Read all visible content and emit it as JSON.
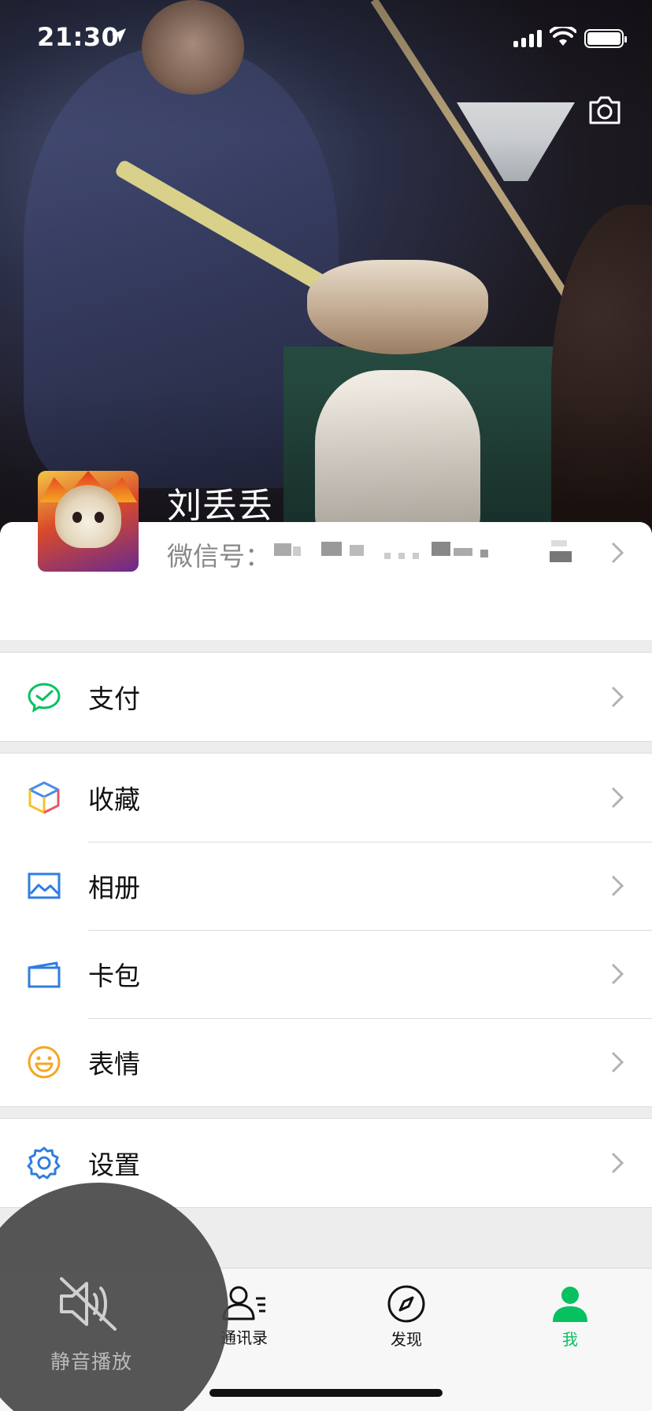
{
  "status_bar": {
    "time": "21:30"
  },
  "profile": {
    "nickname": "刘丢丢",
    "wechat_id_label": "微信号："
  },
  "menu": {
    "group1": [
      {
        "label": "支付",
        "icon": "wechat-pay-icon"
      }
    ],
    "group2": [
      {
        "label": "收藏",
        "icon": "favorites-cube-icon"
      },
      {
        "label": "相册",
        "icon": "album-picture-icon"
      },
      {
        "label": "卡包",
        "icon": "card-wallet-icon"
      },
      {
        "label": "表情",
        "icon": "sticker-smile-icon"
      }
    ],
    "group3": [
      {
        "label": "设置",
        "icon": "settings-gear-icon"
      }
    ]
  },
  "tabbar": {
    "tabs": [
      {
        "label": "通讯录",
        "icon": "contacts-icon"
      },
      {
        "label": "发现",
        "icon": "discover-compass-icon"
      },
      {
        "label": "我",
        "icon": "me-person-icon",
        "active": true
      }
    ],
    "active_color": "#07c160"
  },
  "mute_overlay": {
    "label": "静音播放",
    "icon": "speaker-muted-icon"
  }
}
